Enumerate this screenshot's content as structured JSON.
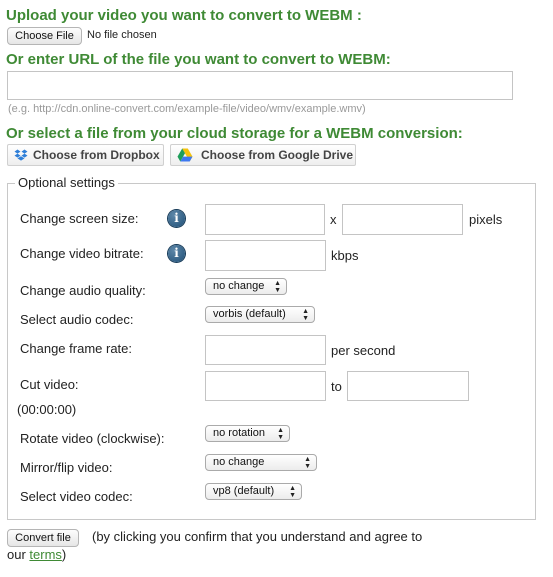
{
  "upload": {
    "heading": "Upload your video you want to convert to WEBM :",
    "choose_file_label": "Choose File",
    "file_status": "No file chosen"
  },
  "url": {
    "heading": "Or enter URL of the file you want to convert to WEBM:",
    "value": "",
    "hint": "(e.g. http://cdn.online-convert.com/example-file/video/wmv/example.wmv)"
  },
  "cloud": {
    "heading": "Or select a file from your cloud storage for a WEBM conversion:",
    "dropbox_label": "Choose from Dropbox",
    "gdrive_label": "Choose from Google Drive",
    "dropbox_color": "#2f7fd8",
    "gdrive_colors": [
      "#f4c20d",
      "#1e9e5a",
      "#3d78f0"
    ]
  },
  "optional": {
    "legend": "Optional settings",
    "screen_size": {
      "label": "Change screen size:",
      "x_label": "x",
      "unit": "pixels",
      "width": "",
      "height": ""
    },
    "bitrate": {
      "label": "Change video bitrate:",
      "unit": "kbps",
      "value": ""
    },
    "audio_quality": {
      "label": "Change audio quality:",
      "selected": "no change"
    },
    "audio_codec": {
      "label": "Select audio codec:",
      "selected": "vorbis (default)"
    },
    "frame_rate": {
      "label": "Change frame rate:",
      "unit": "per second",
      "value": ""
    },
    "cut_video": {
      "label": "Cut video:",
      "format_hint": "(00:00:00)",
      "to_label": "to",
      "from": "",
      "to": ""
    },
    "rotate": {
      "label": "Rotate video (clockwise):",
      "selected": "no rotation"
    },
    "mirror": {
      "label": "Mirror/flip video:",
      "selected": "no change"
    },
    "video_codec": {
      "label": "Select video codec:",
      "selected": "vp8 (default)"
    },
    "info_glyph": "i"
  },
  "footer": {
    "convert_label": "Convert file",
    "agree_text_1": "(by clicking you confirm that you understand and agree to",
    "agree_text_2": "our ",
    "terms_label": "terms",
    "agree_text_3": ")"
  },
  "colors": {
    "heading_green": "#3f8a35",
    "info_blue": "#1f4f77",
    "hint_gray": "#999999"
  }
}
